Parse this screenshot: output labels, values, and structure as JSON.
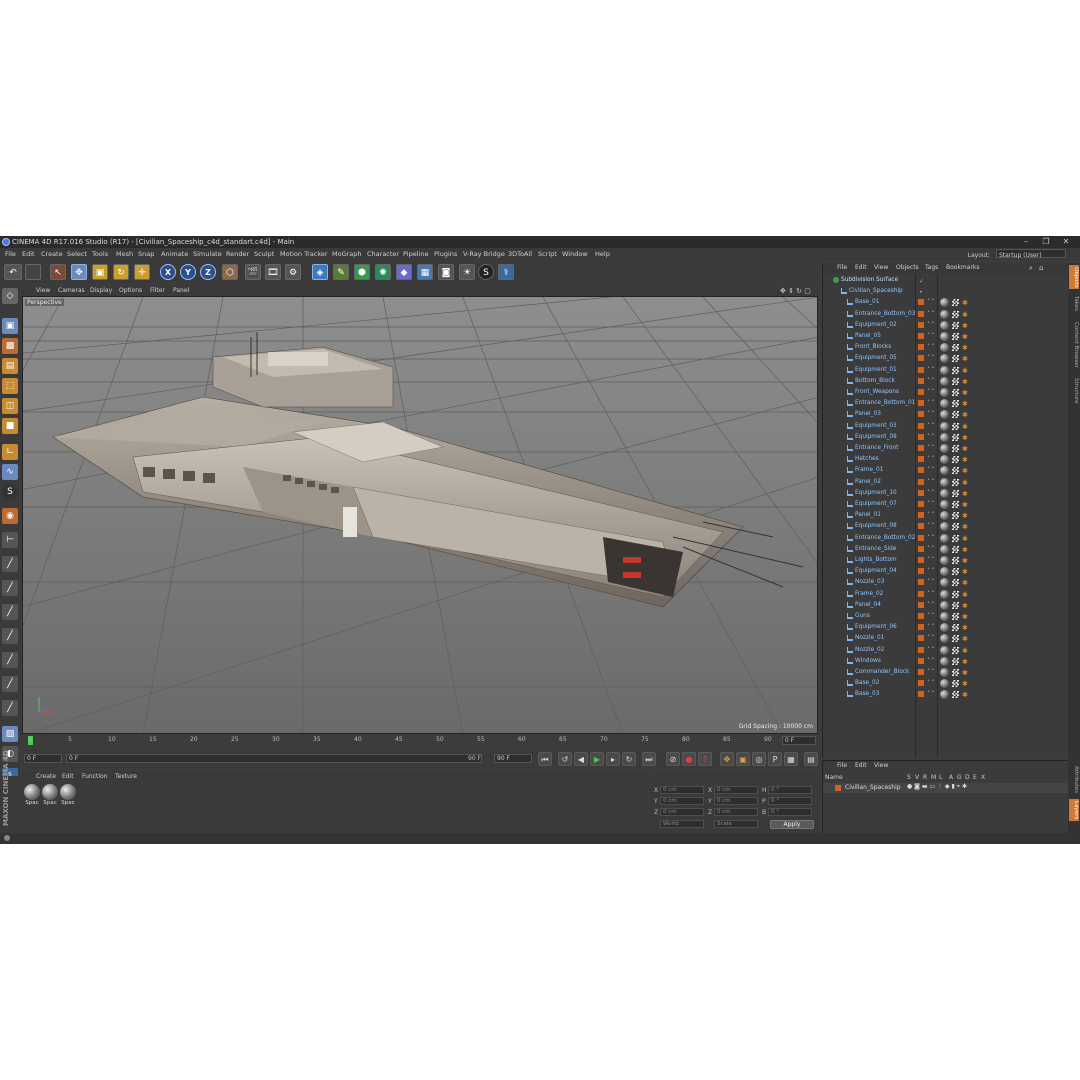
{
  "window": {
    "title": "CINEMA 4D R17.016 Studio (R17) - [Civilian_Spaceship_c4d_standart.c4d] - Main",
    "controls": [
      "–",
      "❐",
      "✕"
    ]
  },
  "menu": [
    "File",
    "Edit",
    "Create",
    "Select",
    "Tools",
    "Mesh",
    "Snap",
    "Animate",
    "Simulate",
    "Render",
    "Sculpt",
    "Motion Tracker",
    "MoGraph",
    "Character",
    "Pipeline",
    "Plugins",
    "V-Ray Bridge",
    "3DToAll",
    "Script",
    "Window",
    "Help"
  ],
  "layout": {
    "label": "Layout:",
    "value": "Startup (User)"
  },
  "toolbar": {
    "undo": "↶",
    "axes": [
      "X",
      "Y",
      "Z"
    ]
  },
  "viewport": {
    "menu": [
      "View",
      "Cameras",
      "Display",
      "Options",
      "Filter",
      "Panel"
    ],
    "label": "Perspective",
    "grid_info": "Grid Spacing : 10000 cm"
  },
  "timeline": {
    "ticks": [
      "0",
      "5",
      "10",
      "15",
      "20",
      "25",
      "30",
      "35",
      "40",
      "45",
      "50",
      "55",
      "60",
      "65",
      "70",
      "75",
      "80",
      "85",
      "90"
    ],
    "current_frame": "0 F"
  },
  "transport": {
    "start": "0 F",
    "min": "0 F",
    "max": "90 F",
    "end": "90 F"
  },
  "materials": {
    "menu": [
      "Create",
      "Edit",
      "Function",
      "Texture"
    ],
    "items": [
      "Spac",
      "Spac",
      "Spac"
    ]
  },
  "coords": {
    "rows": [
      {
        "a": "X",
        "av": "0 cm",
        "b": "X",
        "bv": "0 cm",
        "c": "H",
        "cv": "0 °"
      },
      {
        "a": "Y",
        "av": "0 cm",
        "b": "Y",
        "bv": "0 cm",
        "c": "P",
        "cv": "0 °"
      },
      {
        "a": "Z",
        "av": "0 cm",
        "b": "Z",
        "bv": "0 cm",
        "c": "B",
        "cv": "0 °"
      }
    ],
    "mode": "World",
    "scale": "Scale",
    "apply": "Apply"
  },
  "brand": "MAXON CINEMA 4D",
  "objects": {
    "menu": [
      "File",
      "Edit",
      "View",
      "Objects",
      "Tags",
      "Bookmarks"
    ],
    "root": "Subdivision Surface",
    "group": "Civilian_Spaceship",
    "children": [
      "Base_01",
      "Entrance_Bottom_03",
      "Equipment_02",
      "Panel_05",
      "Front_Blocks",
      "Equipment_05",
      "Equipment_01",
      "Bottom_Block",
      "Front_Weapons",
      "Entrance_Bottom_01",
      "Panel_03",
      "Equipment_03",
      "Equipment_09",
      "Entrance_Front",
      "Hatches",
      "Frame_01",
      "Panel_02",
      "Equipment_10",
      "Equipment_07",
      "Panel_01",
      "Equipment_08",
      "Entrance_Bottom_02",
      "Entrance_Side",
      "Lights_Bottom",
      "Equipment_04",
      "Nozzle_03",
      "Frame_02",
      "Panel_04",
      "Guns",
      "Equipment_06",
      "Nozzle_01",
      "Nozzle_02",
      "Windows",
      "Commander_Block",
      "Base_02",
      "Base_03"
    ]
  },
  "layers": {
    "menu": [
      "File",
      "Edit",
      "View"
    ],
    "columns": [
      "Name",
      "S",
      "V",
      "R",
      "M",
      "L",
      "A",
      "G",
      "D",
      "E",
      "X"
    ],
    "row": "Civilian_Spaceship"
  },
  "side_tabs": [
    "Objects",
    "Takes",
    "Content Browser",
    "Structure"
  ],
  "side_tabs_bottom": [
    "Attributes",
    "Layers"
  ],
  "colors": {
    "accent": "#d07a3a",
    "object_name": "#8fc6ff",
    "layer_orange": "#d0631f"
  }
}
